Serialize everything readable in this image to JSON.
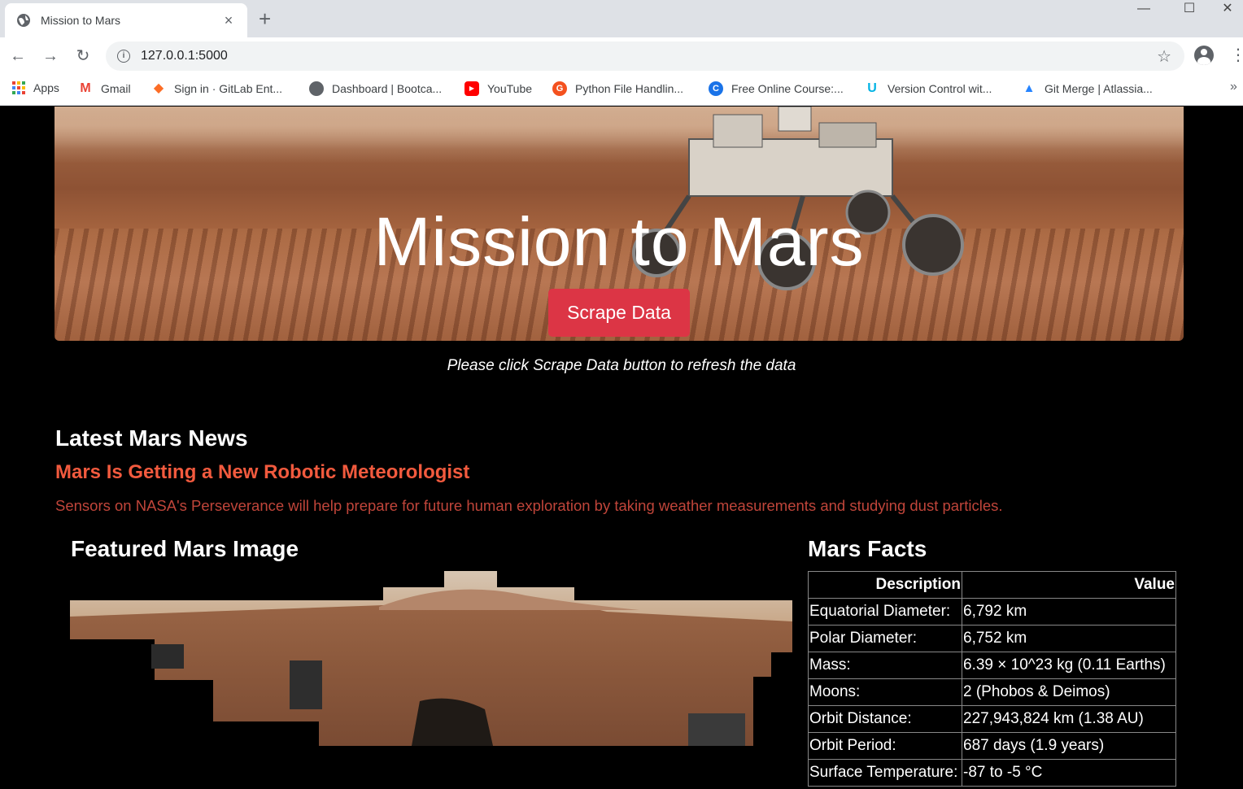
{
  "browser": {
    "tab_title": "Mission to Mars",
    "tab_close": "×",
    "new_tab": "+",
    "url": "127.0.0.1:5000",
    "bookmarks": [
      {
        "label": "Apps",
        "icon": "apps-grid-icon"
      },
      {
        "label": "Gmail",
        "icon": "gmail-icon",
        "color": "#ea4335",
        "glyph": "M"
      },
      {
        "label": "Sign in · GitLab Ent...",
        "icon": "gitlab-icon",
        "color": "#fc6d26",
        "glyph": "◆"
      },
      {
        "label": "Dashboard | Bootca...",
        "icon": "globe-icon",
        "color": "#5f6368",
        "glyph": "◉"
      },
      {
        "label": "YouTube",
        "icon": "youtube-icon",
        "color": "#ff0000",
        "glyph": "▶"
      },
      {
        "label": "Python File Handlin...",
        "icon": "python-site-icon",
        "color": "#f4511e",
        "glyph": "G"
      },
      {
        "label": "Free Online Course:...",
        "icon": "coursera-icon",
        "color": "#1a73e8",
        "glyph": "C"
      },
      {
        "label": "Version Control wit...",
        "icon": "udacity-icon",
        "color": "#02b3e4",
        "glyph": "U"
      },
      {
        "label": "Git Merge | Atlassia...",
        "icon": "atlassian-icon",
        "color": "#2684ff",
        "glyph": "▲"
      }
    ],
    "bookmarks_more": "»"
  },
  "hero": {
    "title": "Mission to Mars",
    "button_label": "Scrape Data",
    "button_color": "#dc3545"
  },
  "hint": "Please click Scrape Data button to refresh the data",
  "news": {
    "heading": "Latest Mars News",
    "title": "Mars Is Getting a New Robotic Meteorologist",
    "paragraph": "Sensors on NASA's Perseverance will help prepare for future human exploration by taking weather measurements and studying dust particles.",
    "title_color": "#f25a3e",
    "paragraph_color": "#c0453a"
  },
  "featured_image": {
    "heading": "Featured Mars Image"
  },
  "facts": {
    "heading": "Mars Facts",
    "columns": [
      "Description",
      "Value"
    ],
    "rows": [
      [
        "Equatorial Diameter:",
        "6,792 km"
      ],
      [
        "Polar Diameter:",
        "6,752 km"
      ],
      [
        "Mass:",
        "6.39 × 10^23 kg (0.11 Earths)"
      ],
      [
        "Moons:",
        "2 (Phobos & Deimos)"
      ],
      [
        "Orbit Distance:",
        "227,943,824 km (1.38 AU)"
      ],
      [
        "Orbit Period:",
        "687 days (1.9 years)"
      ],
      [
        "Surface Temperature:",
        "-87 to -5 °C"
      ]
    ]
  }
}
